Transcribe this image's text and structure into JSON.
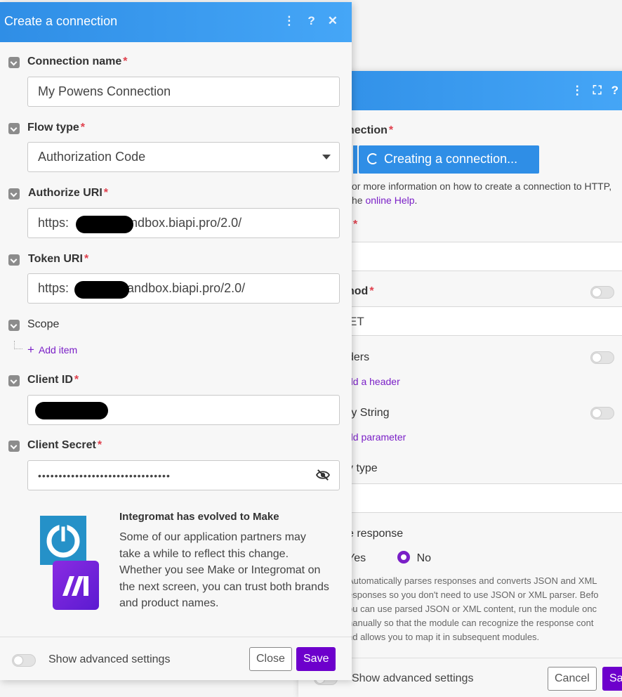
{
  "back_panel": {
    "header_icons": [
      "more-vertical-icon",
      "expand-icon",
      "help-icon"
    ],
    "connection_label": "nection",
    "creating_button": "Creating a connection...",
    "help_text_1": "or more information on how to create a connection to HTTP,",
    "help_text_2_prefix": "he ",
    "help_link": "online Help",
    "help_text_2_suffix": ".",
    "url_star": "*",
    "method_label": "hod",
    "method_value": "ET",
    "headers_label": "ders",
    "add_header": "dd a header",
    "query_label": "ry String",
    "add_parameter": "dd parameter",
    "body_type_label": "y type",
    "parse_label": "e response",
    "radio_yes": "Yes",
    "radio_no": "No",
    "description": [
      "Automatically parses responses and converts JSON and XML",
      "esponses so you don't need to use JSON or XML parser. Befo",
      "ou can use parsed JSON or XML content, run the module onc",
      "nanually so that the module can recognize the response cont",
      "nd allows you to map it in subsequent modules."
    ],
    "advanced_label": "Show advanced settings",
    "cancel_label": "Cancel",
    "save_label": "Sa"
  },
  "front_panel": {
    "title": "Create a connection",
    "header_icons": [
      "more-vertical-icon",
      "help-icon",
      "close-icon"
    ],
    "required_mark": "*",
    "connection_name_label": "Connection name",
    "connection_name_value": "My Powens Connection",
    "flow_type_label": "Flow type",
    "flow_type_value": "Authorization Code",
    "authorize_uri_label": "Authorize URI",
    "authorize_uri_prefix": "https:",
    "authorize_uri_suffix": "andbox.biapi.pro/2.0/",
    "token_uri_label": "Token URI",
    "token_uri_prefix": "https:",
    "token_uri_suffix": "sandbox.biapi.pro/2.0/",
    "scope_label": "Scope",
    "add_item": "Add item",
    "client_id_label": "Client ID",
    "client_secret_label": "Client Secret",
    "client_secret_value": "••••••••••••••••••••••••••••••••",
    "brand_title": "Integromat has evolved to Make",
    "brand_text": "Some of our application partners may take a while to reflect this change. Whether you see Make or Integromat on the next screen, you can trust both brands and product names.",
    "advanced_label": "Show advanced settings",
    "close_label": "Close",
    "save_label": "Save"
  },
  "colors": {
    "header_blue": "#2f8ee6",
    "accent_purple": "#6d00cc",
    "required_red": "#e0404d"
  }
}
